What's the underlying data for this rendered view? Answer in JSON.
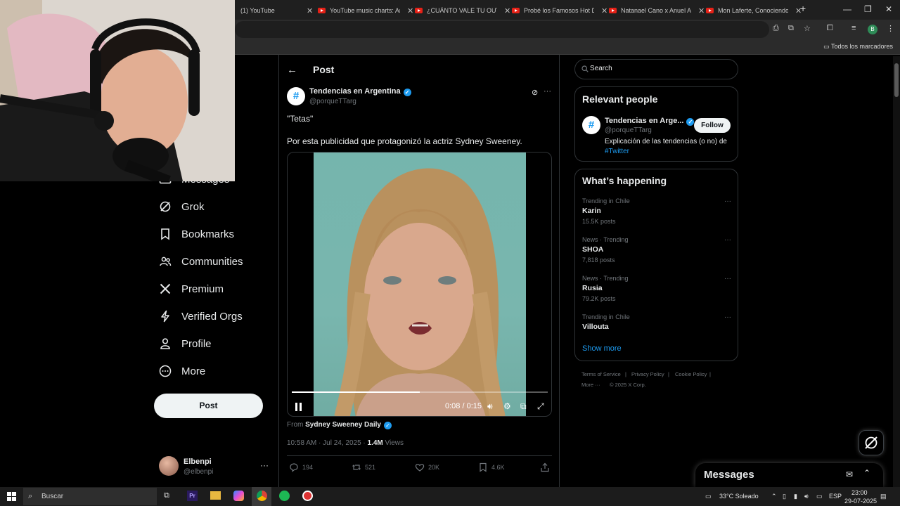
{
  "browser": {
    "tabs": [
      {
        "label": "(1) YouTube"
      },
      {
        "label": "YouTube music charts: Ar"
      },
      {
        "label": "¿CUÁNTO VALE TU OUTF"
      },
      {
        "label": "Probé los Famosos Hot D"
      },
      {
        "label": "Natanael Cano x Anuel A"
      },
      {
        "label": "Mon Laferte, Conociendo"
      }
    ],
    "profile_letter": "B",
    "bookmarks_all": "Todos los marcadores"
  },
  "nav": {
    "items": [
      {
        "label": "Messages",
        "icon": "envelope-icon"
      },
      {
        "label": "Grok",
        "icon": "grok-icon"
      },
      {
        "label": "Bookmarks",
        "icon": "bookmark-icon"
      },
      {
        "label": "Communities",
        "icon": "communities-icon"
      },
      {
        "label": "Premium",
        "icon": "x-logo-icon"
      },
      {
        "label": "Verified Orgs",
        "icon": "lightning-icon"
      },
      {
        "label": "Profile",
        "icon": "person-icon"
      },
      {
        "label": "More",
        "icon": "more-circle-icon"
      }
    ],
    "post_button": "Post",
    "account": {
      "name": "Elbenpi",
      "handle": "@elbenpi"
    }
  },
  "post": {
    "header": "Post",
    "author": {
      "name": "Tendencias en Argentina",
      "handle": "@porqueTTarg",
      "avatar_glyph": "#"
    },
    "text1": "\"Tetas\"",
    "text2": "Por esta publicidad que protagonizó la actriz Sydney Sweeney.",
    "video": {
      "time": "0:08 / 0:15",
      "progress": 0.5
    },
    "from_label": "From",
    "from_source": "Sydney Sweeney Daily",
    "timestamp": "10:58 AM · Jul 24, 2025 ·",
    "views_count": "1.4M",
    "views_label": "Views",
    "stats": {
      "replies": "194",
      "reposts": "521",
      "likes": "20K",
      "bookmarks": "4.6K"
    }
  },
  "sidebar": {
    "search_placeholder": "Search",
    "relevant_title": "Relevant people",
    "relevant_person": {
      "name": "Tendencias en Arge...",
      "handle": "@porqueTTarg",
      "follow_label": "Follow",
      "bio": "Explicación de las tendencias (o no) de",
      "bio_tag": "#Twitter"
    },
    "happening_title": "What’s happening",
    "trends": [
      {
        "context": "Trending in Chile",
        "name": "Karin",
        "count": "15.5K posts"
      },
      {
        "context": "News · Trending",
        "name": "SHOA",
        "count": "7,818 posts"
      },
      {
        "context": "News · Trending",
        "name": "Rusia",
        "count": "79.2K posts"
      },
      {
        "context": "Trending in Chile",
        "name": "Villouta",
        "count": ""
      }
    ],
    "show_more": "Show more",
    "footer": {
      "terms": "Terms of Service",
      "privacy": "Privacy Policy",
      "cookie": "Cookie Policy",
      "more": "More ···",
      "copyright": "© 2025 X Corp."
    }
  },
  "messages_dock": {
    "title": "Messages"
  },
  "taskbar": {
    "search": "Buscar",
    "weather": "33°C  Soleado",
    "lang": "ESP",
    "time": "23:00",
    "date": "29-07-2025"
  },
  "colors": {
    "accent": "#1d9bf0",
    "background": "#000000",
    "border": "#2f3336"
  }
}
